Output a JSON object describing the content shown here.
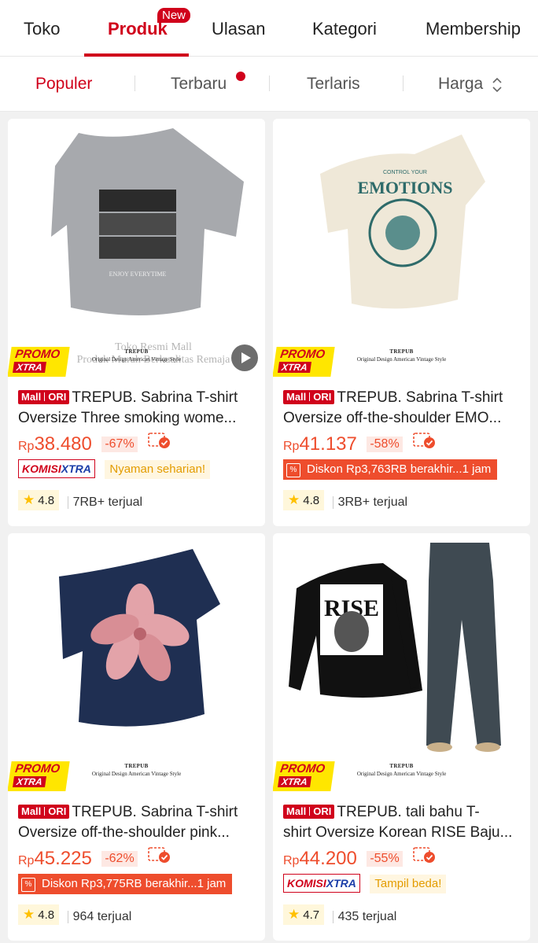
{
  "tabs": {
    "items": [
      "Toko",
      "Produk",
      "Ulasan",
      "Kategori",
      "Membership"
    ],
    "active": "Produk",
    "new_badge": "New"
  },
  "sort": {
    "items": [
      "Populer",
      "Terbaru",
      "Terlaris",
      "Harga"
    ],
    "active": "Populer"
  },
  "colors": {
    "accent": "#d0011b",
    "price": "#ee4d2d",
    "promo_yellow": "#ffe600"
  },
  "products": [
    {
      "mall_label": "Mall",
      "ori_label": "ORI",
      "title_line1": "TREPUB. Sabrina T-shirt",
      "title_line2": "Oversize Three smoking wome...",
      "currency": "Rp",
      "price": "38.480",
      "discount": "-67%",
      "tag_type": "komisi",
      "komisi_a": "KOMISI",
      "komisi_b": "XTRA",
      "chip": "Nyaman seharian!",
      "rating": "4.8",
      "sold": "7RB+ terjual",
      "promo_top": "PROMO",
      "promo_bottom": "XTRA",
      "img_brand": "TREPUB",
      "img_tagline": "Original Design American Vintage Style",
      "watermark": "Toko Resmi Mall\nProduk Murah Berkualitas Remaja",
      "has_video": true
    },
    {
      "mall_label": "Mall",
      "ori_label": "ORI",
      "title_line1": "TREPUB. Sabrina T-shirt",
      "title_line2": "Oversize off-the-shoulder EMO...",
      "currency": "Rp",
      "price": "41.137",
      "discount": "-58%",
      "tag_type": "diskon",
      "diskon": "Diskon Rp3,763RB berakhir...1 jam",
      "rating": "4.8",
      "sold": "3RB+ terjual",
      "promo_top": "PROMO",
      "promo_bottom": "XTRA",
      "img_brand": "TREPUB",
      "img_tagline": "Original Design American Vintage Style",
      "print_text": "EMOTIONS",
      "print_sub": "CONTROL YOUR"
    },
    {
      "mall_label": "Mall",
      "ori_label": "ORI",
      "title_line1": "TREPUB. Sabrina T-shirt",
      "title_line2": "Oversize off-the-shoulder pink...",
      "currency": "Rp",
      "price": "45.225",
      "discount": "-62%",
      "tag_type": "diskon",
      "diskon": "Diskon Rp3,775RB berakhir...1 jam",
      "rating": "4.8",
      "sold": "964 terjual",
      "promo_top": "PROMO",
      "promo_bottom": "XTRA",
      "img_brand": "TREPUB",
      "img_tagline": "Original Design American Vintage Style"
    },
    {
      "mall_label": "Mall",
      "ori_label": "ORI",
      "title_line1": "TREPUB. tali bahu T-",
      "title_line2": "shirt Oversize Korean RISE Baju...",
      "currency": "Rp",
      "price": "44.200",
      "discount": "-55%",
      "tag_type": "komisi",
      "komisi_a": "KOMISI",
      "komisi_b": "XTRA",
      "chip": "Tampil beda!",
      "rating": "4.7",
      "sold": "435 terjual",
      "promo_top": "PROMO",
      "promo_bottom": "XTRA",
      "img_brand": "TREPUB",
      "img_tagline": "Original Design American Vintage Style",
      "print_text": "RISE"
    }
  ]
}
